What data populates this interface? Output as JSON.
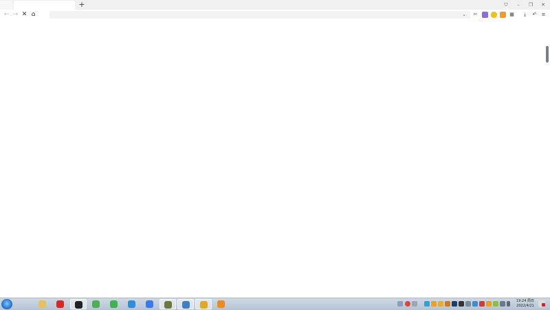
{
  "browser": {
    "tab": {
      "title": ""
    },
    "address_bar": {
      "value": "",
      "placeholder": ""
    },
    "icons": {
      "new_tab": "+",
      "shield": "⛉",
      "minimize": "–",
      "restore": "❐",
      "close": "✕",
      "back": "←",
      "forward": "→",
      "stop": "✕",
      "home": "⌂",
      "dropdown": "⌄",
      "download": "⤓",
      "undo": "↶",
      "menu": "≡"
    }
  },
  "taskbar": {
    "clock": {
      "time": "19:24 周日",
      "date": "2022/4/21"
    },
    "pinned_apps": [
      {
        "name": "file-explorer",
        "color": "#e8c15a"
      },
      {
        "name": "netease-music",
        "color": "#e02424"
      },
      {
        "name": "obs",
        "color": "#222222"
      },
      {
        "name": "green-app",
        "color": "#4caf50"
      },
      {
        "name": "media-player",
        "color": "#3fb34f"
      },
      {
        "name": "sync-app",
        "color": "#2e8ddc"
      },
      {
        "name": "feishu",
        "color": "#3a7af0"
      },
      {
        "name": "game-app",
        "color": "#6b7a3a"
      },
      {
        "name": "photo-app",
        "color": "#3b7fc4"
      },
      {
        "name": "browser-app",
        "color": "#e2a81e"
      },
      {
        "name": "help-app",
        "color": "#f08a1c"
      }
    ]
  },
  "colors": {
    "tabstrip": "#f0f0f0",
    "scrollbar": "#7a7f85",
    "taskbar": "#c3d0e0"
  }
}
